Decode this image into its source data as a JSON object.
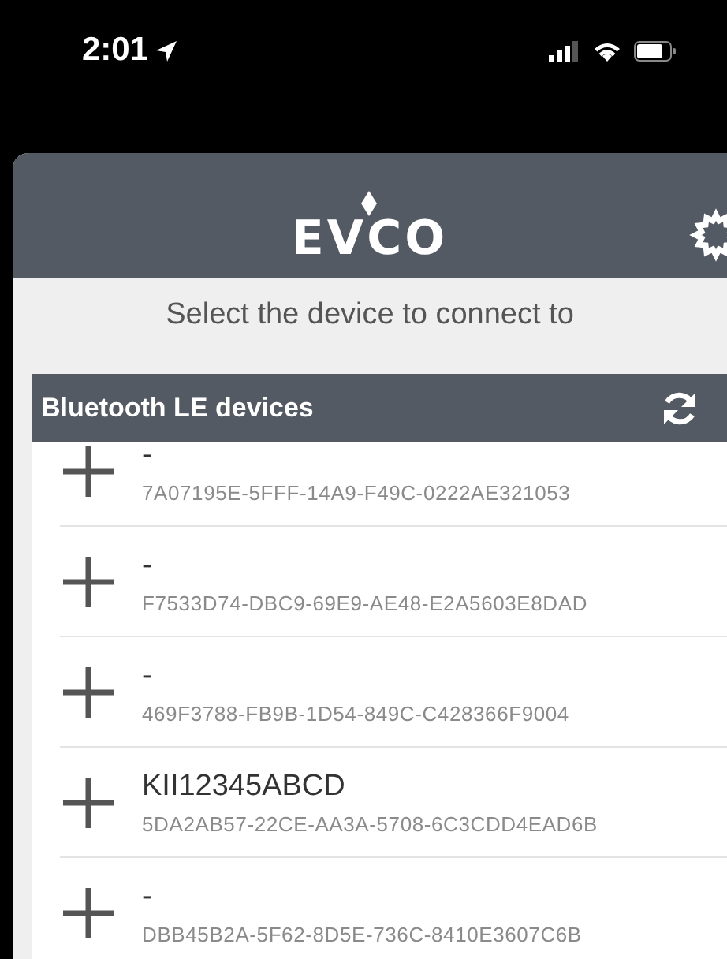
{
  "status_bar": {
    "time": "2:01"
  },
  "header": {
    "logo": "EVCO"
  },
  "subtitle": "Select the device to connect to",
  "section": {
    "title": "Bluetooth LE devices"
  },
  "devices": [
    {
      "name": "-",
      "uuid": "7A07195E-5FFF-14A9-F49C-0222AE321053"
    },
    {
      "name": "-",
      "uuid": "F7533D74-DBC9-69E9-AE48-E2A5603E8DAD"
    },
    {
      "name": "-",
      "uuid": "469F3788-FB9B-1D54-849C-C428366F9004"
    },
    {
      "name": "KII12345ABCD",
      "uuid": "5DA2AB57-22CE-AA3A-5708-6C3CDD4EAD6B"
    },
    {
      "name": "-",
      "uuid": "DBB45B2A-5F62-8D5E-736C-8410E3607C6B"
    }
  ]
}
